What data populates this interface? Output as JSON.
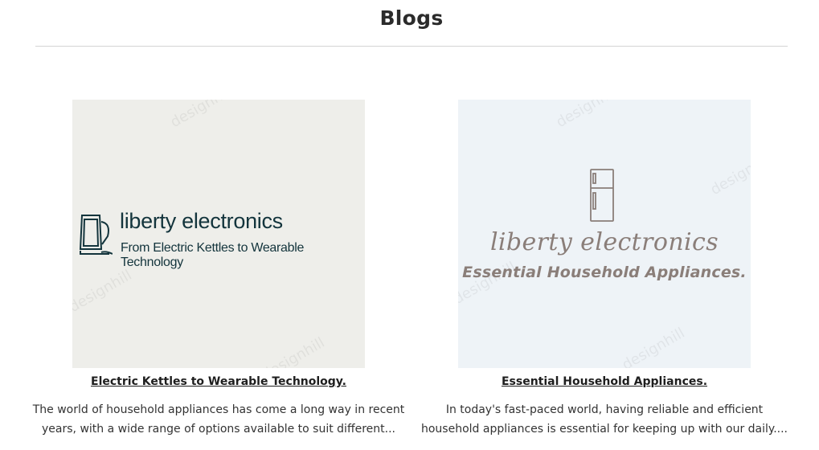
{
  "page": {
    "title": "Blogs"
  },
  "posts": [
    {
      "image": {
        "logo_title": "liberty electronics",
        "logo_subtitle": "From Electric Kettles to Wearable Technology",
        "icon": "kettle-icon",
        "watermark": "designhill"
      },
      "title": "Electric Kettles to Wearable Technology.",
      "excerpt_line1": "The world of household appliances has come a long way in recent",
      "excerpt_line2": "years, with a wide range of options available to suit different..."
    },
    {
      "image": {
        "logo_title": "liberty electronics",
        "logo_subtitle": "Essential Household Appliances.",
        "icon": "refrigerator-icon",
        "watermark": "designhill"
      },
      "title": "Essential Household Appliances.",
      "excerpt_line1": "In today's fast-paced world, having reliable and efficient",
      "excerpt_line2": "household appliances is essential for keeping up with our daily...."
    }
  ],
  "colors": {
    "logo_dark_teal": "#13343c",
    "logo_taupe": "#8a7e79",
    "thumb_a_bg": "#eeeeea",
    "thumb_b_bg": "#eef3f7"
  }
}
